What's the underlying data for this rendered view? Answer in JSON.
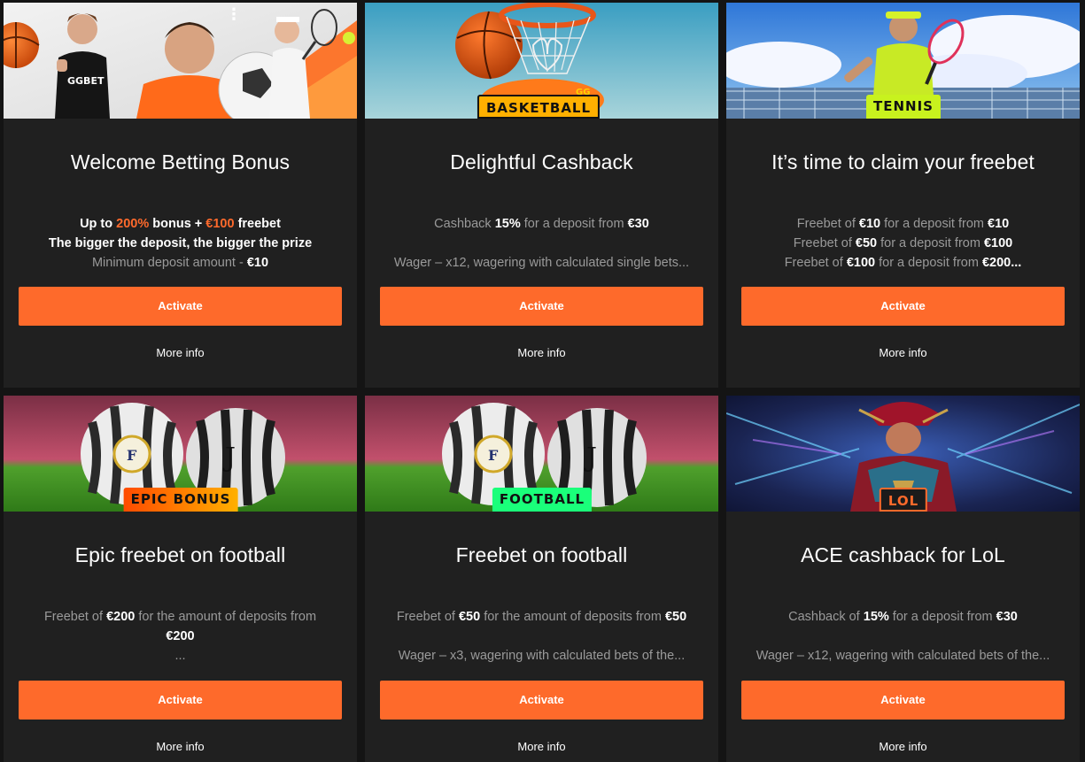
{
  "cards": [
    {
      "title": "Welcome Betting Bonus",
      "badge": "",
      "line1a": "Up to ",
      "line1b": "200%",
      "line1c": " bonus + ",
      "line1d": "€100",
      "line1e": " freebet",
      "line2": "The bigger the deposit, the bigger the prize",
      "line3a": "Minimum deposit amount - ",
      "line3b": "€10",
      "activate": "Activate",
      "more": "More info"
    },
    {
      "title": "Delightful Cashback",
      "badge": "BASKETBALL",
      "line1a": "Cashback ",
      "line1b": "15%",
      "line1c": " for a deposit from ",
      "line1d": "€30",
      "line2": "Wager – x12, wagering with calculated single bets...",
      "activate": "Activate",
      "more": "More info"
    },
    {
      "title": "It’s time to claim your freebet",
      "badge": "TENNIS",
      "line1a": "Freebet of ",
      "line1b": "€10",
      "line1c": " for a deposit from ",
      "line1d": "€10",
      "line2a": "Freebet of ",
      "line2b": "€50",
      "line2c": " for a deposit from ",
      "line2d": "€100",
      "line3a": "Freebet of ",
      "line3b": "€100",
      "line3c": " for a deposit from ",
      "line3d": "€200...",
      "activate": "Activate",
      "more": "More info"
    },
    {
      "title": "Epic freebet on football",
      "badge": "EPIC BONUS",
      "line1a": "Freebet of ",
      "line1b": "€200",
      "line1c": " for the amount of deposits from",
      "line2": "€200",
      "line3": "...",
      "activate": "Activate",
      "more": "More info"
    },
    {
      "title": "Freebet on football",
      "badge": "FOOTBALL",
      "line1a": "Freebet of ",
      "line1b": "€50",
      "line1c": " for the amount of deposits from ",
      "line1d": "€50",
      "line2": "Wager – x3, wagering with calculated bets of the...",
      "activate": "Activate",
      "more": "More info"
    },
    {
      "title": "ACE cashback for LoL",
      "badge": "LOL",
      "line1a": "Cashback of ",
      "line1b": "15%",
      "line1c": " for a deposit from ",
      "line1d": "€30",
      "line2": "Wager – x12, wagering with calculated bets of the...",
      "activate": "Activate",
      "more": "More info"
    }
  ],
  "banner_brand": "GGBET",
  "colors": {
    "accent": "#fe6a2b",
    "card_bg": "#202020",
    "page_bg": "#141414",
    "muted_text": "#9a9a9a"
  }
}
